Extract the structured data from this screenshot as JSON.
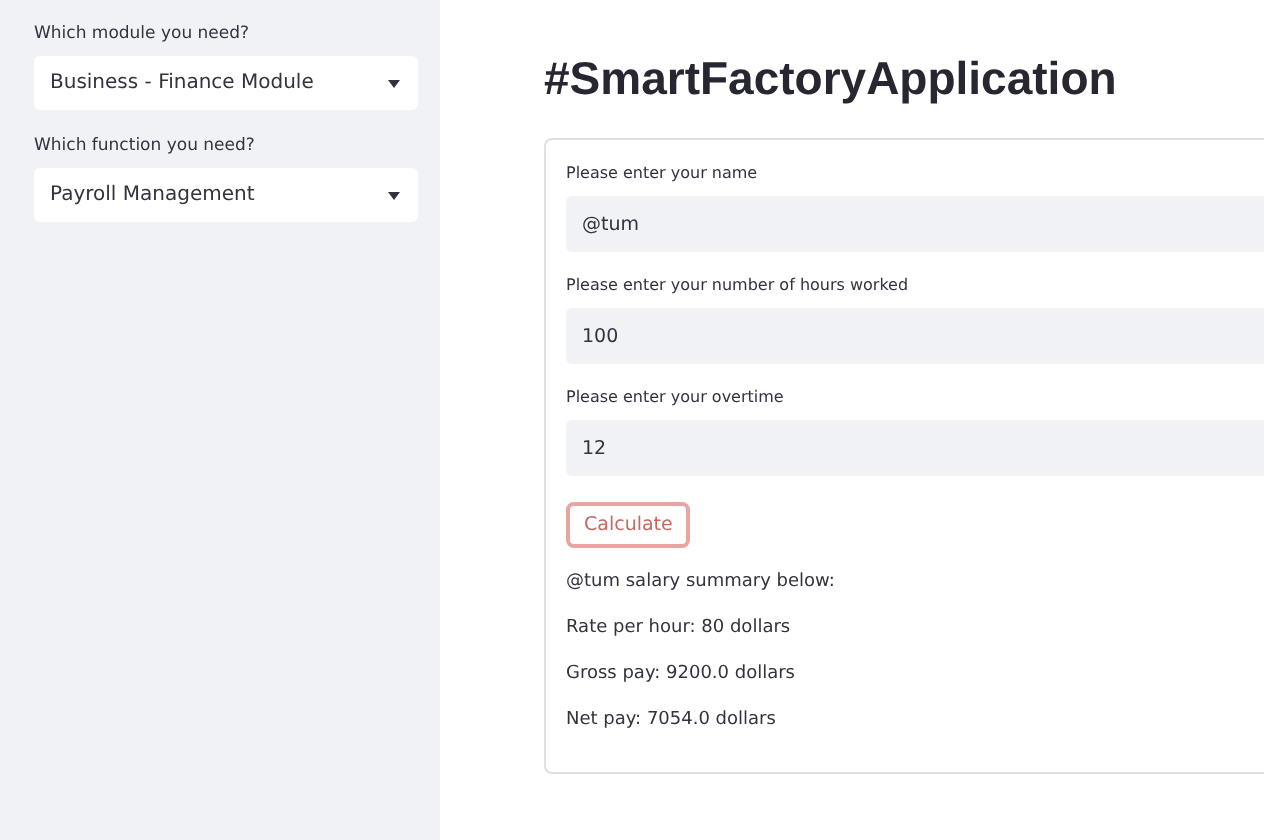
{
  "sidebar": {
    "selects": [
      {
        "label": "Which module you need?",
        "value": "Business - Finance Module"
      },
      {
        "label": "Which function you need?",
        "value": "Payroll Management"
      }
    ]
  },
  "title": "#SmartFactoryApplication",
  "form": {
    "fields": [
      {
        "label": "Please enter your name",
        "value": "@tum"
      },
      {
        "label": "Please enter your number of hours worked",
        "value": "100"
      },
      {
        "label": "Please enter your overtime",
        "value": "12"
      }
    ],
    "button": "Calculate",
    "results": [
      "@tum salary summary below:",
      "Rate per hour: 80 dollars",
      "Gross pay: 9200.0 dollars",
      "Net pay: 7054.0 dollars"
    ]
  }
}
